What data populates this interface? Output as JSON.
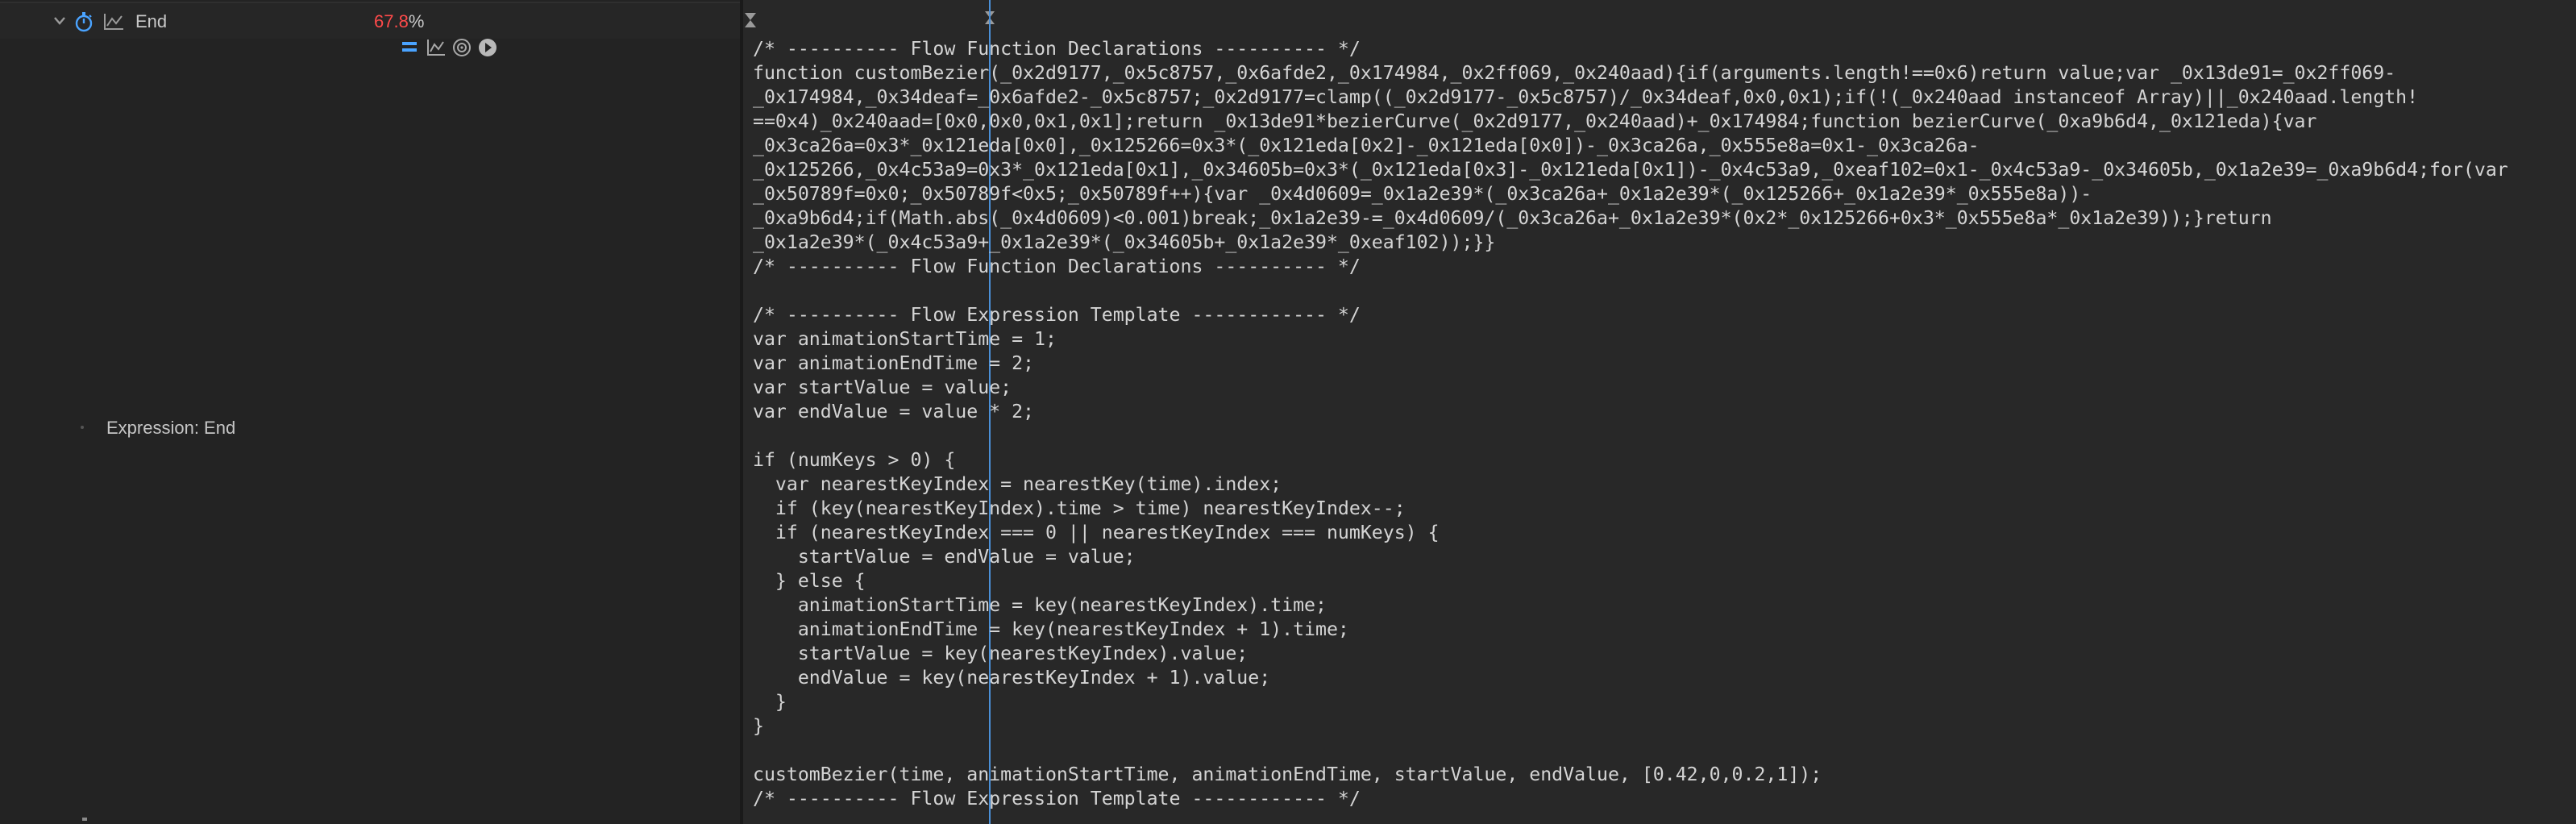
{
  "layer": {
    "property_name": "End",
    "value_number": "67.8",
    "value_unit": "%",
    "expression_label": "Expression: End"
  },
  "colors": {
    "value_red": "#ff4a4a",
    "playhead_blue": "#4a8fd6",
    "accent_blue": "#4aa3ff"
  },
  "icons": {
    "chevron": "chevron-down-icon",
    "stopwatch": "stopwatch-icon",
    "graph": "graph-icon",
    "expr_enable": "equals-icon",
    "expr_graph": "graph-icon",
    "pickwhip": "pickwhip-icon",
    "language_menu": "play-circle-icon"
  },
  "code_lines": [
    "/* ---------- Flow Function Declarations ---------- */",
    "function customBezier(_0x2d9177,_0x5c8757,_0x6afde2,_0x174984,_0x2ff069,_0x240aad){if(arguments.length!==0x6)return value;var _0x13de91=_0x2ff069-",
    "_0x174984,_0x34deaf=_0x6afde2-_0x5c8757;_0x2d9177=clamp((_0x2d9177-_0x5c8757)/_0x34deaf,0x0,0x1);if(!(_0x240aad instanceof Array)||_0x240aad.length!",
    "==0x4)_0x240aad=[0x0,0x0,0x1,0x1];return _0x13de91*bezierCurve(_0x2d9177,_0x240aad)+_0x174984;function bezierCurve(_0xa9b6d4,_0x121eda){var",
    "_0x3ca26a=0x3*_0x121eda[0x0],_0x125266=0x3*(_0x121eda[0x2]-_0x121eda[0x0])-_0x3ca26a,_0x555e8a=0x1-_0x3ca26a-",
    "_0x125266,_0x4c53a9=0x3*_0x121eda[0x1],_0x34605b=0x3*(_0x121eda[0x3]-_0x121eda[0x1])-_0x4c53a9,_0xeaf102=0x1-_0x4c53a9-_0x34605b,_0x1a2e39=_0xa9b6d4;for(var",
    "_0x50789f=0x0;_0x50789f<0x5;_0x50789f++){var _0x4d0609=_0x1a2e39*(_0x3ca26a+_0x1a2e39*(_0x125266+_0x1a2e39*_0x555e8a))-",
    "_0xa9b6d4;if(Math.abs(_0x4d0609)<0.001)break;_0x1a2e39-=_0x4d0609/(_0x3ca26a+_0x1a2e39*(0x2*_0x125266+0x3*_0x555e8a*_0x1a2e39));}return",
    "_0x1a2e39*(_0x4c53a9+_0x1a2e39*(_0x34605b+_0x1a2e39*_0xeaf102));}}",
    "/* ---------- Flow Function Declarations ---------- */",
    "",
    "/* ---------- Flow Expression Template ------------ */",
    "var animationStartTime = 1;",
    "var animationEndTime = 2;",
    "var startValue = value;",
    "var endValue = value * 2;",
    "",
    "if (numKeys > 0) {",
    "  var nearestKeyIndex = nearestKey(time).index;",
    "  if (key(nearestKeyIndex).time > time) nearestKeyIndex--;",
    "  if (nearestKeyIndex === 0 || nearestKeyIndex === numKeys) {",
    "    startValue = endValue = value;",
    "  } else {",
    "    animationStartTime = key(nearestKeyIndex).time;",
    "    animationEndTime = key(nearestKeyIndex + 1).time;",
    "    startValue = key(nearestKeyIndex).value;",
    "    endValue = key(nearestKeyIndex + 1).value;",
    "  }",
    "}",
    "",
    "customBezier(time, animationStartTime, animationEndTime, startValue, endValue, [0.42,0,0.2,1]);",
    "/* ---------- Flow Expression Template ------------ */"
  ]
}
